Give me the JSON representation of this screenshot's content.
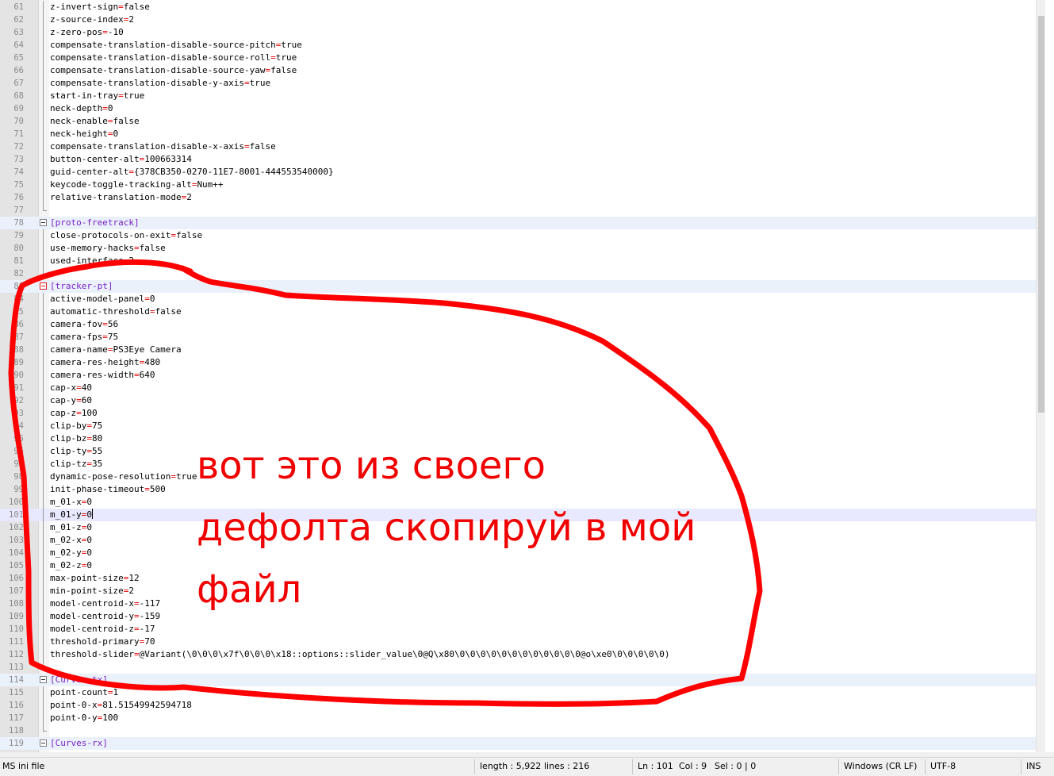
{
  "editor": {
    "lines": [
      {
        "n": "61",
        "k": "z-invert-sign",
        "v": "false"
      },
      {
        "n": "62",
        "k": "z-source-index",
        "v": "2"
      },
      {
        "n": "63",
        "k": "z-zero-pos",
        "v": "-10"
      },
      {
        "n": "64",
        "k": "compensate-translation-disable-source-pitch",
        "v": "true"
      },
      {
        "n": "65",
        "k": "compensate-translation-disable-source-roll",
        "v": "true"
      },
      {
        "n": "66",
        "k": "compensate-translation-disable-source-yaw",
        "v": "false"
      },
      {
        "n": "67",
        "k": "compensate-translation-disable-y-axis",
        "v": "true"
      },
      {
        "n": "68",
        "k": "start-in-tray",
        "v": "true"
      },
      {
        "n": "69",
        "k": "neck-depth",
        "v": "0"
      },
      {
        "n": "70",
        "k": "neck-enable",
        "v": "false"
      },
      {
        "n": "71",
        "k": "neck-height",
        "v": "0"
      },
      {
        "n": "72",
        "k": "compensate-translation-disable-x-axis",
        "v": "false"
      },
      {
        "n": "73",
        "k": "button-center-alt",
        "v": "100663314"
      },
      {
        "n": "74",
        "k": "guid-center-alt",
        "v": "{378CB350-0270-11E7-8001-444553540000}"
      },
      {
        "n": "75",
        "k": "keycode-toggle-tracking-alt",
        "v": "Num++"
      },
      {
        "n": "76",
        "k": "relative-translation-mode",
        "v": "2"
      },
      {
        "n": "77",
        "blank": true,
        "end": true
      },
      {
        "n": "78",
        "section": "[proto-freetrack]"
      },
      {
        "n": "79",
        "k": "close-protocols-on-exit",
        "v": "false"
      },
      {
        "n": "80",
        "k": "use-memory-hacks",
        "v": "false"
      },
      {
        "n": "81",
        "raw": "used-interface=2"
      },
      {
        "n": "82",
        "blank": true,
        "end": true
      },
      {
        "n": "83",
        "section": "[tracker-pt]",
        "red": true
      },
      {
        "n": "84",
        "k": "active-model-panel",
        "v": "0"
      },
      {
        "n": "85",
        "k": "automatic-threshold",
        "v": "false"
      },
      {
        "n": "86",
        "k": "camera-fov",
        "v": "56"
      },
      {
        "n": "87",
        "k": "camera-fps",
        "v": "75"
      },
      {
        "n": "88",
        "k": "camera-name",
        "v": "PS3Eye Camera"
      },
      {
        "n": "89",
        "k": "camera-res-height",
        "v": "480"
      },
      {
        "n": "90",
        "k": "camera-res-width",
        "v": "640"
      },
      {
        "n": "91",
        "k": "cap-x",
        "v": "40"
      },
      {
        "n": "92",
        "k": "cap-y",
        "v": "60"
      },
      {
        "n": "93",
        "k": "cap-z",
        "v": "100"
      },
      {
        "n": "94",
        "k": "clip-by",
        "v": "75"
      },
      {
        "n": "95",
        "k": "clip-bz",
        "v": "80"
      },
      {
        "n": "96",
        "k": "clip-ty",
        "v": "55"
      },
      {
        "n": "97",
        "k": "clip-tz",
        "v": "35"
      },
      {
        "n": "98",
        "k": "dynamic-pose-resolution",
        "v": "true"
      },
      {
        "n": "99",
        "k": "init-phase-timeout",
        "v": "500"
      },
      {
        "n": "100",
        "k": "m_01-x",
        "v": "0"
      },
      {
        "n": "101",
        "k": "m_01-y",
        "v": "0",
        "current": true
      },
      {
        "n": "102",
        "k": "m_01-z",
        "v": "0"
      },
      {
        "n": "103",
        "k": "m_02-x",
        "v": "0"
      },
      {
        "n": "104",
        "k": "m_02-y",
        "v": "0"
      },
      {
        "n": "105",
        "k": "m_02-z",
        "v": "0"
      },
      {
        "n": "106",
        "k": "max-point-size",
        "v": "12"
      },
      {
        "n": "107",
        "k": "min-point-size",
        "v": "2"
      },
      {
        "n": "108",
        "k": "model-centroid-x",
        "v": "-117"
      },
      {
        "n": "109",
        "k": "model-centroid-y",
        "v": "-159"
      },
      {
        "n": "110",
        "k": "model-centroid-z",
        "v": "-17"
      },
      {
        "n": "111",
        "k": "threshold-primary",
        "v": "70"
      },
      {
        "n": "112",
        "k": "threshold-slider",
        "v": "@Variant(\\0\\0\\0\\x7f\\0\\0\\0\\x18::options::slider_value\\0@Q\\x80\\0\\0\\0\\0\\0\\0\\0\\0\\0\\0\\0\\0@o\\xe0\\0\\0\\0\\0\\0)"
      },
      {
        "n": "113",
        "blank": true,
        "end": true
      },
      {
        "n": "114",
        "section": "[Curves-tx]"
      },
      {
        "n": "115",
        "k": "point-count",
        "v": "1"
      },
      {
        "n": "116",
        "k": "point-0-x",
        "v": "81.51549942594718"
      },
      {
        "n": "117",
        "k": "point-0-y",
        "v": "100"
      },
      {
        "n": "118",
        "blank": true,
        "end": true
      },
      {
        "n": "119",
        "section": "[Curves-rx]"
      }
    ]
  },
  "annotation": {
    "lines": [
      "вот это из своего",
      "дефолта скопируй в мой",
      "файл"
    ],
    "color": "#f00000"
  },
  "statusbar": {
    "filetype": "MS ini file",
    "length": "length : 5,922",
    "lines": "lines : 216",
    "ln": "Ln : 101",
    "col": "Col : 9",
    "sel": "Sel : 0 | 0",
    "eol": "Windows (CR LF)",
    "encoding": "UTF-8",
    "mode": "INS"
  }
}
